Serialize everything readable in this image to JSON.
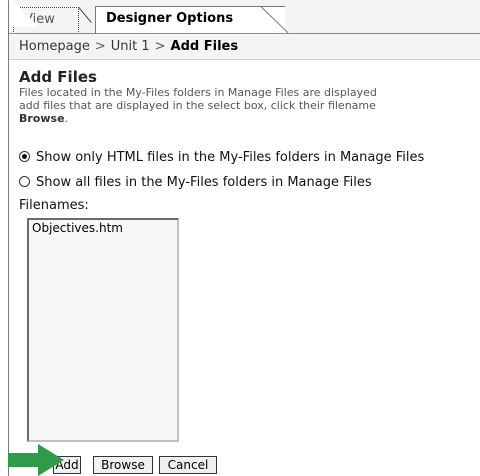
{
  "tabs": {
    "view": "View",
    "designer": "Designer Options"
  },
  "breadcrumb": {
    "home": "Homepage",
    "sep": ">",
    "unit": "Unit 1",
    "current": "Add Files"
  },
  "main": {
    "title": "Add Files",
    "desc_line1": "Files located in the My-Files folders in Manage Files are displayed",
    "desc_line2": "add files that are displayed in the select box, click their filename",
    "desc_line3_bold": "Browse",
    "desc_line3_end": ".",
    "radio1": "Show only HTML files in the My-Files folders in Manage Files",
    "radio2": "Show all files in the My-Files folders in Manage Files",
    "filenames_label": "Filenames:",
    "files": [
      "Objectives.htm"
    ]
  },
  "buttons": {
    "add": "Add",
    "browse": "Browse",
    "cancel": "Cancel"
  },
  "colors": {
    "arrow": "#2e9a4a"
  }
}
